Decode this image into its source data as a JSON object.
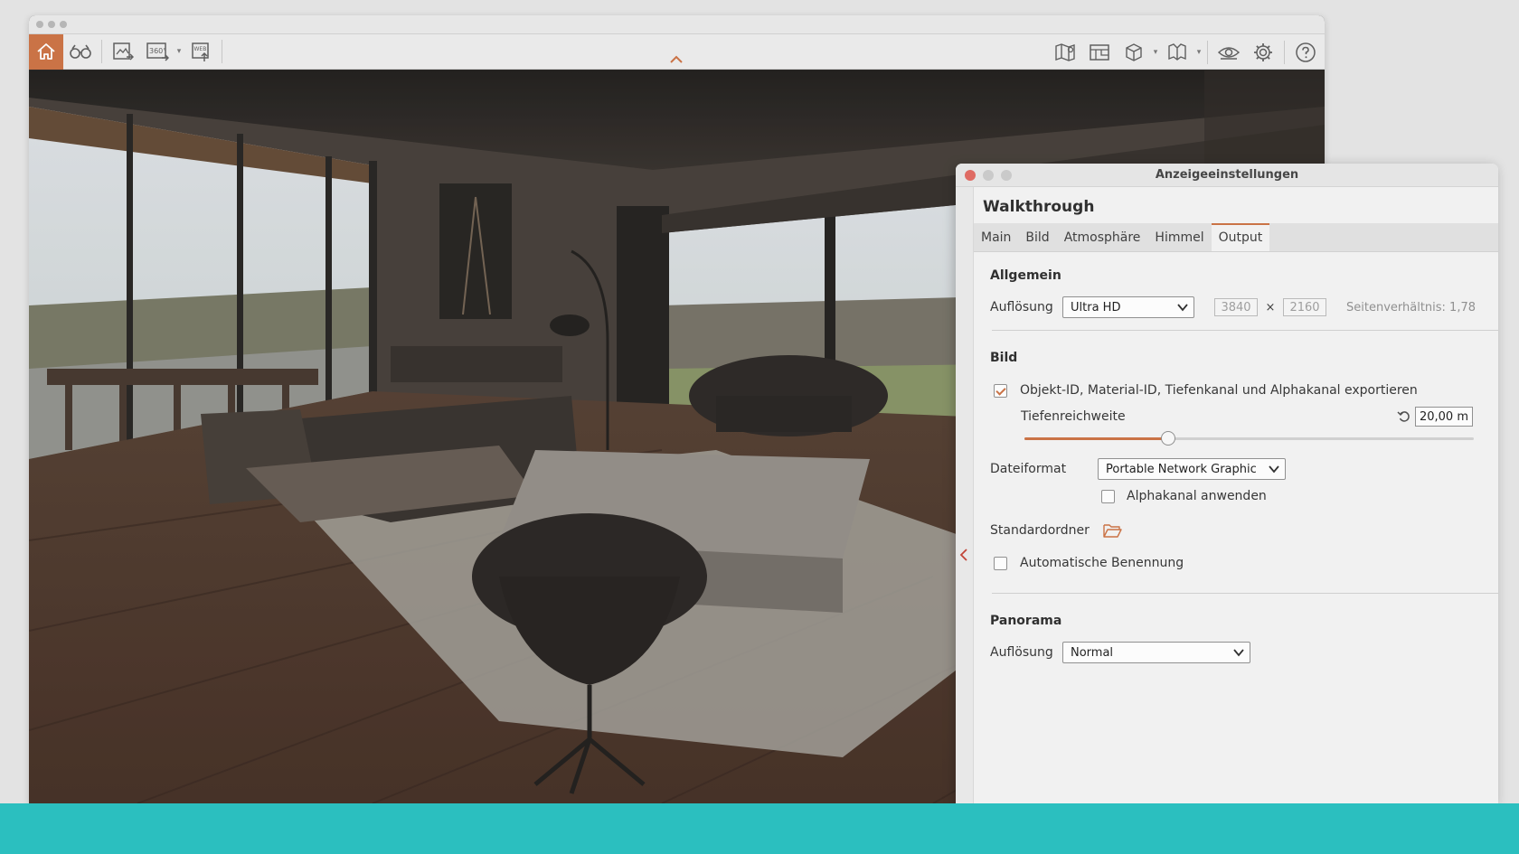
{
  "toolbar": {
    "left_icons": [
      "home-icon",
      "binoculars-icon",
      "image-export-icon",
      "panorama-360-icon",
      "web-export-icon"
    ],
    "right_icons": [
      "map-icon",
      "floorplan-icon",
      "cube-icon",
      "book-icon",
      "eye-icon",
      "gear-icon",
      "help-icon"
    ],
    "accent": "#c96b3a"
  },
  "dialog": {
    "title": "Anzeigeeinstellungen",
    "heading": "Walkthrough",
    "tabs": [
      "Main",
      "Bild",
      "Atmosphäre",
      "Himmel",
      "Output"
    ],
    "active_tab": "Output",
    "allgemein": {
      "title": "Allgemein",
      "resolution_label": "Auflösung",
      "resolution_value": "Ultra HD",
      "width": "3840",
      "times": "×",
      "height": "2160",
      "aspect_ratio": "Seitenverhältnis: 1,78"
    },
    "bild": {
      "title": "Bild",
      "export_checkbox_label": "Objekt-ID, Material-ID, Tiefenkanal und Alphakanal exportieren",
      "export_checked": true,
      "depth_label": "Tiefenreichweite",
      "depth_value": "20,00 m",
      "depth_slider_fraction": 0.32,
      "format_label": "Dateiformat",
      "format_value": "Portable Network Graphic",
      "alpha_label": "Alphakanal anwenden",
      "alpha_checked": false,
      "folder_label": "Standardordner",
      "auto_naming_label": "Automatische Benennung",
      "auto_naming_checked": false
    },
    "panorama": {
      "title": "Panorama",
      "resolution_label": "Auflösung",
      "resolution_value": "Normal"
    }
  },
  "colors": {
    "accent": "#c96b3a",
    "band": "#2bbfbf",
    "close_button": "#e0625a"
  }
}
